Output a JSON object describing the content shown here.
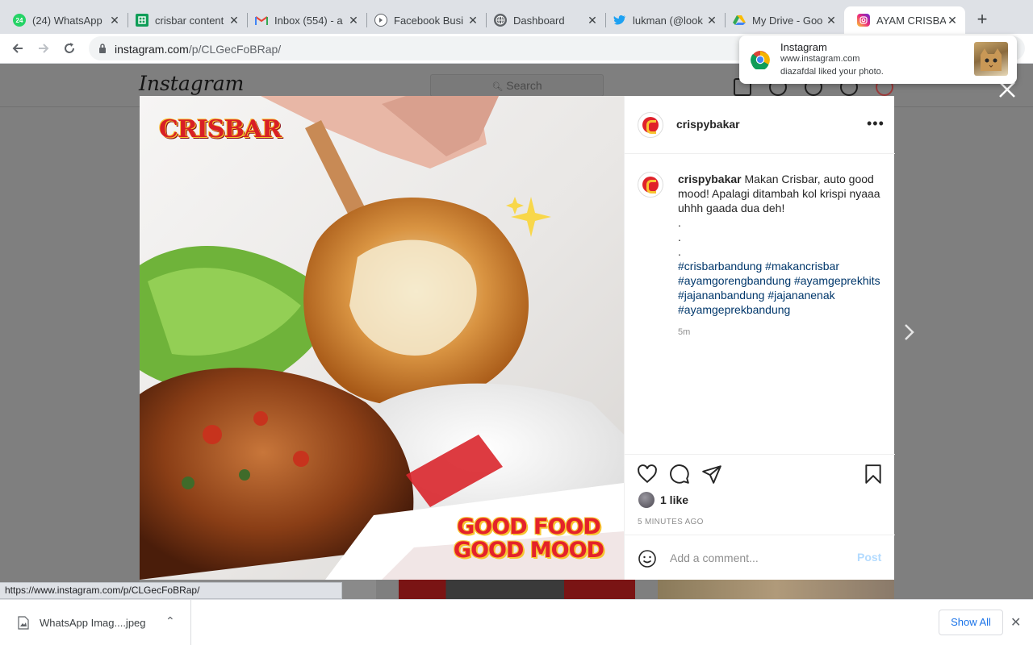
{
  "browser": {
    "tabs": [
      {
        "title": "(24) WhatsApp",
        "icon": "whatsapp-icon",
        "badge": "24"
      },
      {
        "title": "crisbar content",
        "icon": "google-sheets-icon"
      },
      {
        "title": "Inbox (554) - a",
        "icon": "gmail-icon"
      },
      {
        "title": "Facebook Busi",
        "icon": "facebook-business-icon"
      },
      {
        "title": "Dashboard",
        "icon": "globe-icon"
      },
      {
        "title": "lukman (@look",
        "icon": "twitter-icon"
      },
      {
        "title": "My Drive - Goo",
        "icon": "google-drive-icon"
      },
      {
        "title": "AYAM CRISBAR",
        "icon": "instagram-icon",
        "active": true
      }
    ],
    "url_host": "instagram.com",
    "url_path": "/p/CLGecFoBRap/",
    "status_url": "https://www.instagram.com/p/CLGecFoBRap/"
  },
  "instagram": {
    "logo": "Instagram",
    "search_placeholder": "Search"
  },
  "post": {
    "image_brand": "CRISBAR",
    "image_slogan_1": "GOOD FOOD",
    "image_slogan_2": "GOOD MOOD",
    "username": "crispybakar",
    "caption_text": "Makan Crisbar, auto good mood! Apalagi ditambah kol krispi nyaaa uhhh gaada dua deh!",
    "caption_dots": [
      ".",
      ".",
      "."
    ],
    "hashtags": "#crisbarbandung #makancrisbar #ayamgorengbandung #ayamgeprekhits #jajananbandung #jajananenak #ayamgeprekbandung",
    "time": "5m",
    "likes": "1 like",
    "posted_ago": "5 MINUTES AGO",
    "comment_placeholder": "Add a comment...",
    "post_label": "Post"
  },
  "downloads": {
    "file_name": "WhatsApp Imag....jpeg",
    "show_all": "Show All"
  },
  "notification": {
    "title": "Instagram",
    "site": "www.instagram.com",
    "message": "diazafdal liked your photo."
  },
  "colors": {
    "brand_red": "#e4222a",
    "brand_yellow": "#f7c431",
    "hashtag": "#00376b",
    "post_disabled": "#b3dbff"
  }
}
